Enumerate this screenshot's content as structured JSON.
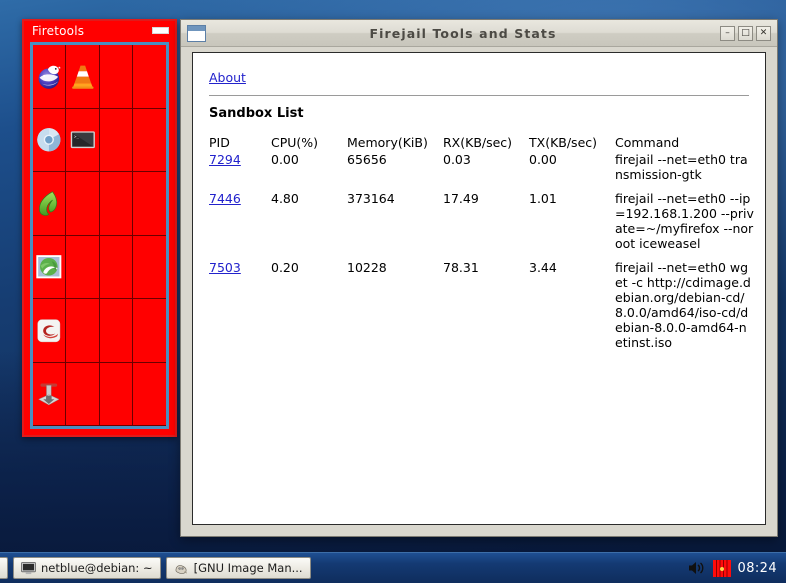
{
  "desktop": {
    "name": "desktop-background"
  },
  "firetools": {
    "title": "Firetools",
    "minimize_label": "—",
    "icons": [
      {
        "name": "iceweasel-icon",
        "label": "Iceweasel"
      },
      {
        "name": "vlc-icon",
        "label": "VLC"
      },
      {
        "name": "chromium-icon",
        "label": "Chromium"
      },
      {
        "name": "terminal-icon",
        "label": "Terminal"
      },
      {
        "name": "midori-icon",
        "label": "Midori"
      },
      {
        "name": "icedove-icon",
        "label": "Icedove"
      },
      {
        "name": "evince-icon",
        "label": "Evince"
      },
      {
        "name": "transmission-icon",
        "label": "Transmission"
      }
    ]
  },
  "firejail": {
    "title": "Firejail Tools and Stats",
    "window_buttons": {
      "minimize": "–",
      "maximize": "□",
      "close": "✕"
    },
    "about_link": "About",
    "section_title": "Sandbox List",
    "table": {
      "headers": [
        "PID",
        "CPU(%)",
        "Memory(KiB)",
        "RX(KB/sec)",
        "TX(KB/sec)",
        "Command"
      ],
      "rows": [
        {
          "pid": "7294",
          "cpu": "0.00",
          "memory": "65656",
          "rx": "0.03",
          "tx": "0.00",
          "command": "firejail --net=eth0 transmission-gtk"
        },
        {
          "pid": "7446",
          "cpu": "4.80",
          "memory": "373164",
          "rx": "17.49",
          "tx": "1.01",
          "command": "firejail --net=eth0 --ip=192.168.1.200 --private=~/myfirefox --noroot iceweasel"
        },
        {
          "pid": "7503",
          "cpu": "0.20",
          "memory": "10228",
          "rx": "78.31",
          "tx": "3.44",
          "command": "firejail --net=eth0 wget -c http://cdimage.debian.org/debian-cd/8.0.0/amd64/iso-cd/debian-8.0.0-amd64-netinst.iso"
        }
      ]
    }
  },
  "taskbar": {
    "buttons": [
      {
        "name": "taskbar-item-terminal",
        "label": "netblue@debian: ~",
        "icon": "terminal-icon"
      },
      {
        "name": "taskbar-item-gimp",
        "label": "[GNU Image Man...",
        "icon": "gimp-icon"
      }
    ],
    "tray": {
      "volume_icon": "speaker-icon",
      "firejail_icon": "firejail-tray-icon",
      "clock": "08:24"
    }
  },
  "colors": {
    "firetools_red": "#ff0000",
    "link_blue": "#2222cc",
    "window_gray": "#d9d7ce",
    "taskbar_blue": "#143a73"
  }
}
